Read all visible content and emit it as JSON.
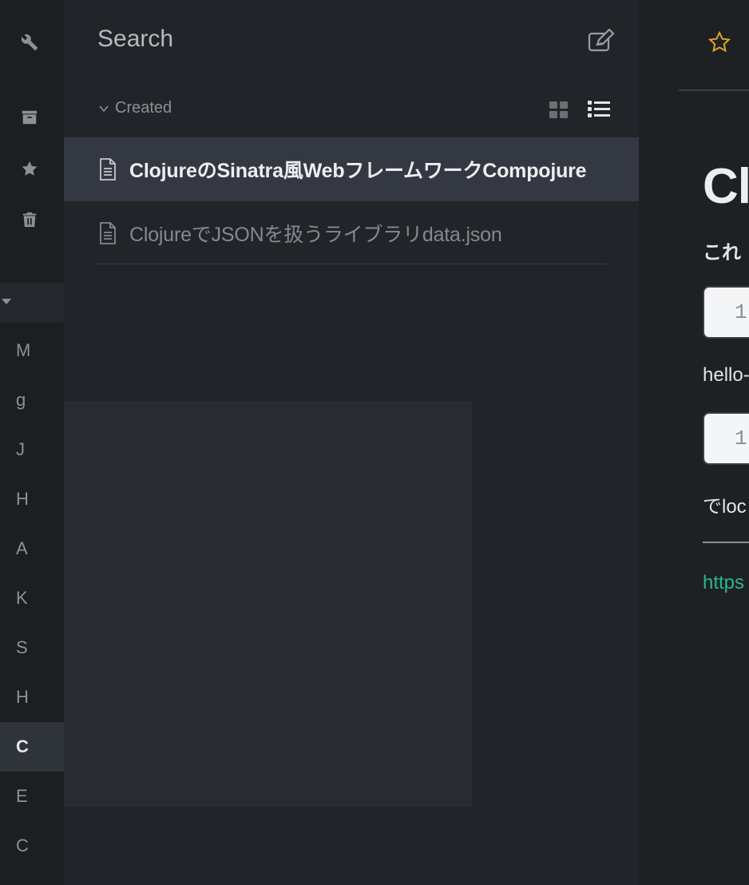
{
  "colors": {
    "accent_star": "#e3a324",
    "link": "#2bb48c",
    "selected_row": "#343842"
  },
  "rail": {
    "icons": [
      "wrench-icon",
      "archive-icon",
      "star-icon",
      "trash-icon"
    ],
    "storage_caret": "caret-down-icon",
    "folders": [
      {
        "letter": "M",
        "active": false
      },
      {
        "letter": "g",
        "active": false
      },
      {
        "letter": "J",
        "active": false
      },
      {
        "letter": "H",
        "active": false
      },
      {
        "letter": "A",
        "active": false
      },
      {
        "letter": "K",
        "active": false
      },
      {
        "letter": "S",
        "active": false
      },
      {
        "letter": "H",
        "active": false
      },
      {
        "letter": "C",
        "active": true
      },
      {
        "letter": "E",
        "active": false
      },
      {
        "letter": "C",
        "active": false
      }
    ]
  },
  "list": {
    "title": "Search",
    "compose_icon": "compose-icon",
    "sort_label": "Created",
    "notes": [
      {
        "title": "ClojureのSinatra風WebフレームワークCompojure",
        "selected": true
      },
      {
        "title": "ClojureでJSONを扱うライブラリdata.json",
        "selected": false
      }
    ]
  },
  "detail": {
    "star_icon": "star-outline-icon",
    "heading": "Cl",
    "para1": "これ",
    "code1_line": "1",
    "para2": "hello-",
    "code2_line": "1",
    "para3": "でloc",
    "link": "https"
  }
}
